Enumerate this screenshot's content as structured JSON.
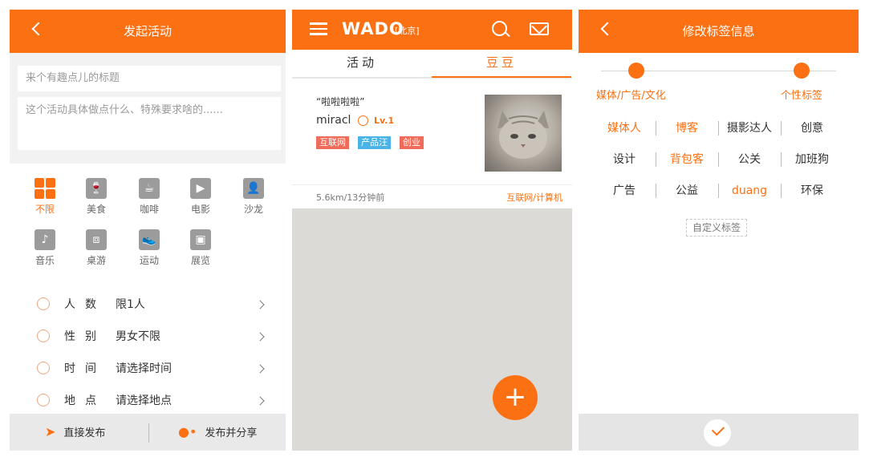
{
  "colors": {
    "accent": "#fb7012",
    "tag_red": "#f06b5a",
    "tag_blue": "#4cb3e6"
  },
  "screen1": {
    "header_title": "发起活动",
    "title_placeholder": "来个有趣点儿的标题",
    "desc_placeholder": "这个活动具体做点什么、特殊要求啥的......",
    "categories": [
      {
        "label": "不限",
        "icon": "grid-icon",
        "active": true
      },
      {
        "label": "美食",
        "icon": "food-icon"
      },
      {
        "label": "咖啡",
        "icon": "coffee-icon"
      },
      {
        "label": "电影",
        "icon": "movie-icon"
      },
      {
        "label": "沙龙",
        "icon": "salon-icon"
      },
      {
        "label": "音乐",
        "icon": "music-icon"
      },
      {
        "label": "桌游",
        "icon": "boardgame-icon"
      },
      {
        "label": "运动",
        "icon": "sport-icon"
      },
      {
        "label": "展览",
        "icon": "exhibition-icon"
      }
    ],
    "rows": [
      {
        "label": "人数",
        "value": "限1人",
        "icon": "people-icon"
      },
      {
        "label": "性别",
        "value": "男女不限",
        "icon": "gender-icon"
      },
      {
        "label": "时间",
        "value": "请选择时间",
        "icon": "clock-icon"
      },
      {
        "label": "地点",
        "value": "请选择地点",
        "icon": "location-icon"
      }
    ],
    "publish_direct": "直接发布",
    "publish_share": "发布并分享"
  },
  "screen2": {
    "logo": "WADO",
    "city": "[北京]",
    "tabs": [
      "活动",
      "豆豆"
    ],
    "active_tab": "豆豆",
    "card": {
      "quote": "“啦啦啦啦”",
      "name": "miracl",
      "level": "Lv.1",
      "tags": [
        "互联网",
        "产品汪",
        "创业"
      ],
      "distance_time": "5.6km/13分钟前",
      "category": "互联网/计算机"
    },
    "fab_label": "+"
  },
  "screen3": {
    "header_title": "修改标签信息",
    "steps": [
      "媒体/广告/文化",
      "个性标签"
    ],
    "tags": [
      [
        "媒体人",
        "博客",
        "摄影达人",
        "创意"
      ],
      [
        "设计",
        "背包客",
        "公关",
        "加班狗"
      ],
      [
        "广告",
        "公益",
        "duang",
        "环保"
      ]
    ],
    "highlighted": [
      "媒体人",
      "博客",
      "背包客",
      "duang"
    ],
    "custom_tag": "自定义标签"
  }
}
